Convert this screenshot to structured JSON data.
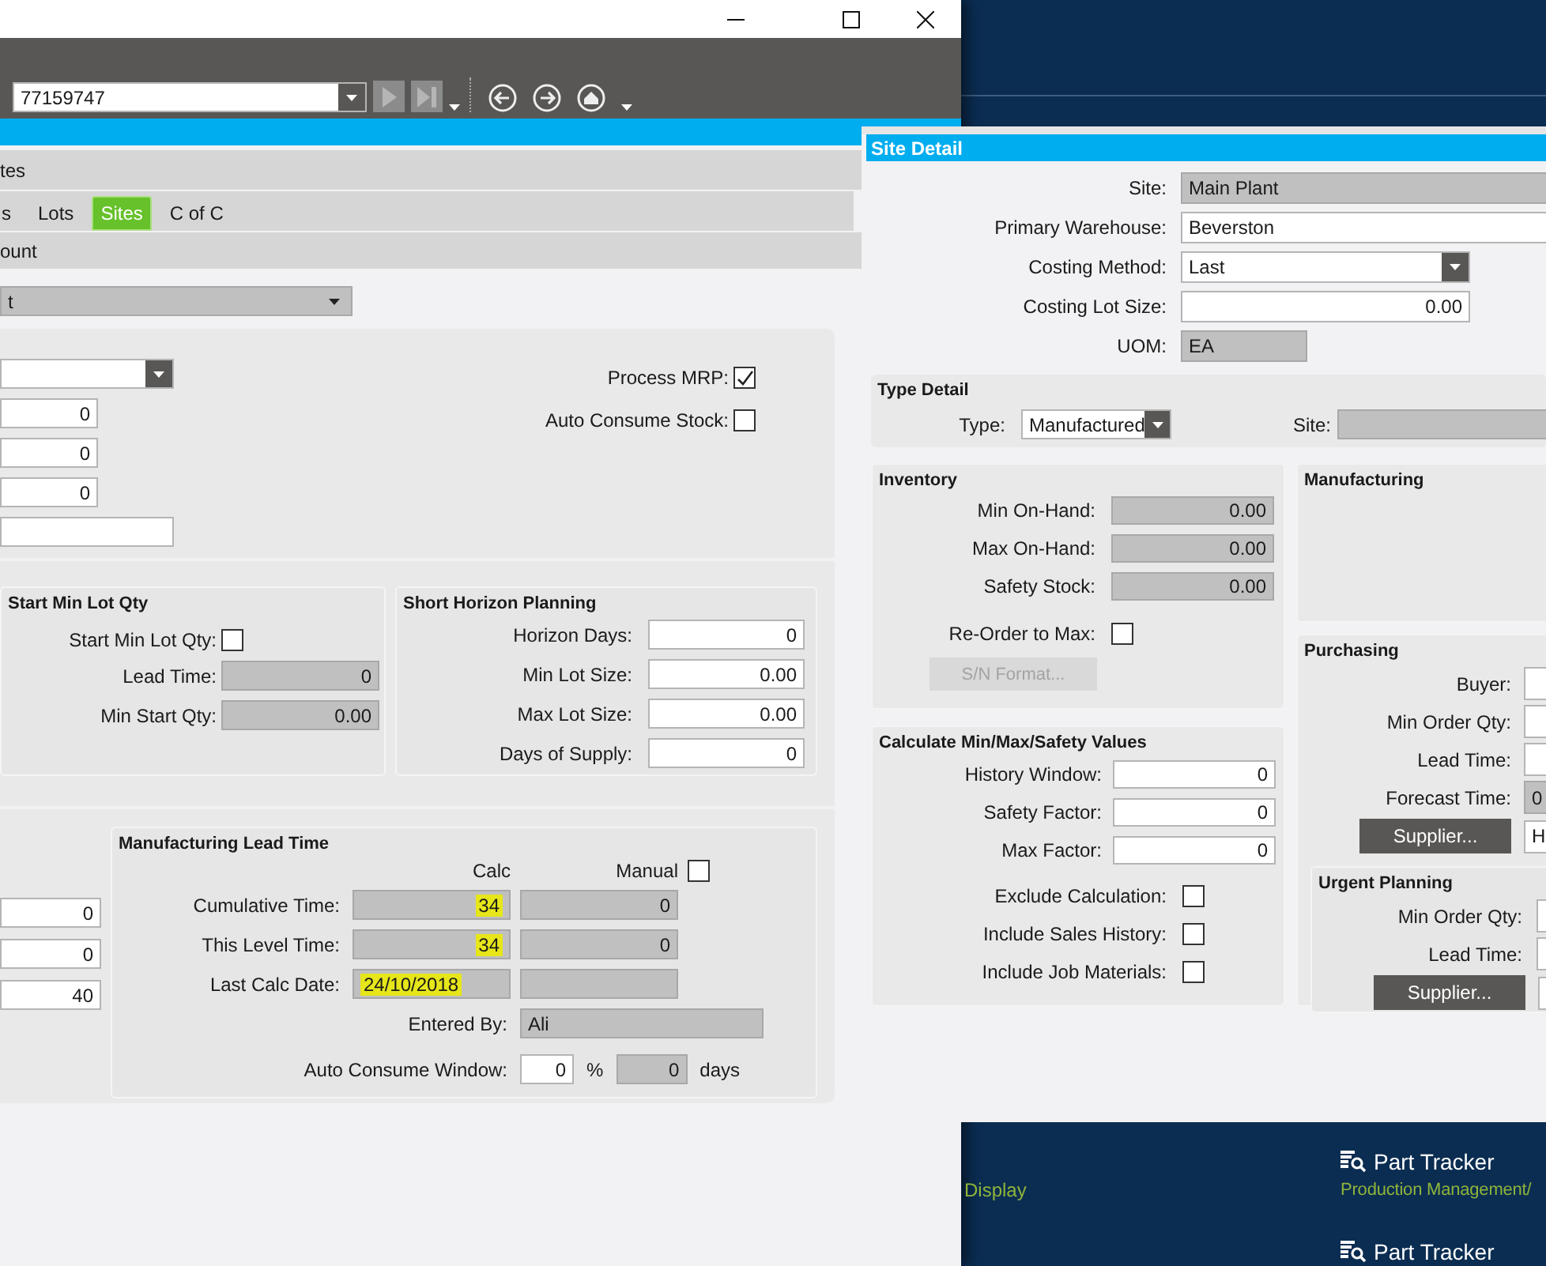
{
  "main_window": {
    "toolbar": {
      "record_field": {
        "kind": "dropdown",
        "value": "77159747"
      }
    },
    "top_bar": {
      "label": "tes"
    },
    "tabs": [
      {
        "label": "s",
        "selected": false
      },
      {
        "label": "Lots",
        "selected": false
      },
      {
        "label": "Sites",
        "selected": true
      },
      {
        "label": "C of C",
        "selected": false
      }
    ],
    "sub_bar": {
      "label": "ount"
    },
    "site_dropdown": {
      "kind": "dropdown",
      "value": "t",
      "read_only": true
    },
    "general_fields": [
      {
        "kind": "dropdown"
      },
      {
        "value": "0"
      },
      {
        "value": "0"
      },
      {
        "value": "0"
      },
      {
        "kind": "text"
      }
    ],
    "checks": [
      {
        "label": "Process MRP:",
        "checked": true
      },
      {
        "label": "Auto Consume Stock:",
        "checked": false
      }
    ],
    "start_min_lot_qty": {
      "title": "Start Min Lot Qty",
      "checkbox": {
        "label": "Start Min Lot Qty:",
        "checked": false
      },
      "fields": [
        {
          "label": "Lead Time:",
          "value": "0",
          "read_only": true
        },
        {
          "label": "Min Start Qty:",
          "value": "0.00",
          "read_only": true
        }
      ]
    },
    "short_horizon_planning": {
      "title": "Short Horizon Planning",
      "fields": [
        {
          "label": "Horizon Days:",
          "value": "0"
        },
        {
          "label": "Min Lot Size:",
          "value": "0.00"
        },
        {
          "label": "Max Lot Size:",
          "value": "0.00"
        },
        {
          "label": "Days of Supply:",
          "value": "0"
        }
      ]
    },
    "lead_fields": [
      {
        "value": "0"
      },
      {
        "value": "0"
      },
      {
        "value": "40"
      }
    ],
    "manufacturing_lead_time": {
      "title": "Manufacturing Lead Time",
      "calc_header": "Calc",
      "manual_header": "Manual",
      "manual_override": {
        "checked": false
      },
      "rows": [
        {
          "label": "Cumulative Time:",
          "calc": {
            "value": "34",
            "read_only": true,
            "highlighted": true
          },
          "manual": {
            "value": "0",
            "read_only": true
          }
        },
        {
          "label": "This Level Time:",
          "calc": {
            "value": "34",
            "read_only": true,
            "highlighted": true
          },
          "manual": {
            "value": "0",
            "read_only": true
          }
        },
        {
          "label": "Last Calc Date:",
          "calc": {
            "kind": "text",
            "value": "24/10/2018",
            "read_only": true,
            "highlighted": true
          },
          "manual": {
            "read_only": true
          }
        }
      ],
      "entered_by": {
        "label": "Entered By:",
        "field": {
          "kind": "text",
          "value": "Ali",
          "read_only": true
        }
      },
      "auto_consume_window": {
        "label": "Auto Consume Window:",
        "percent": {
          "value": "0"
        },
        "percent_sign": "%",
        "days": {
          "value": "0",
          "read_only": true
        },
        "unit": "days"
      }
    }
  },
  "site_detail": {
    "title": "Site Detail",
    "fields": [
      {
        "label": "Site:",
        "kind": "text",
        "value": "Main Plant",
        "read_only": true
      },
      {
        "label": "Primary Warehouse:",
        "kind": "text",
        "value": "Beverston"
      },
      {
        "label": "Costing Method:",
        "kind": "dropdown",
        "value": "Last"
      },
      {
        "label": "Costing Lot Size:",
        "value": "0.00"
      },
      {
        "label": "UOM:",
        "kind": "text",
        "value": "EA",
        "read_only": true
      }
    ],
    "type_detail": {
      "title": "Type Detail",
      "type": {
        "label": "Type:",
        "kind": "dropdown",
        "value": "Manufactured"
      },
      "site": {
        "label": "Site:",
        "read_only": true
      }
    },
    "inventory": {
      "title": "Inventory",
      "fields": [
        {
          "label": "Min On-Hand:",
          "value": "0.00",
          "read_only": true
        },
        {
          "label": "Max On-Hand:",
          "value": "0.00",
          "read_only": true
        },
        {
          "label": "Safety Stock:",
          "value": "0.00",
          "read_only": true
        }
      ],
      "reorder": {
        "label": "Re-Order to Max:",
        "checked": false
      },
      "sn_button": {
        "label": "S/N Format...",
        "disabled": true
      }
    },
    "calculate": {
      "title": "Calculate Min/Max/Safety Values",
      "fields": [
        {
          "label": "History Window:",
          "value": "0"
        },
        {
          "label": "Safety Factor:",
          "value": "0"
        },
        {
          "label": "Max Factor:",
          "value": "0"
        }
      ],
      "checks": [
        {
          "label": "Exclude Calculation:",
          "checked": false
        },
        {
          "label": "Include Sales History:",
          "checked": false
        },
        {
          "label": "Include Job Materials:",
          "checked": false
        }
      ]
    },
    "manufacturing": {
      "title": "Manufacturing"
    },
    "purchasing": {
      "title": "Purchasing",
      "fields": [
        {
          "label": "Buyer:"
        },
        {
          "label": "Min Order Qty:"
        },
        {
          "label": "Lead Time:"
        },
        {
          "label": "Forecast Time:",
          "kind": "text",
          "value": "0",
          "read_only": true
        }
      ],
      "supplier_button": {
        "label": "Supplier..."
      },
      "supplier_field": {
        "kind": "text",
        "value": "H"
      }
    },
    "urgent_planning": {
      "title": "Urgent Planning",
      "fields": [
        {
          "label": "Min Order Qty:"
        },
        {
          "label": "Lead Time:"
        }
      ],
      "supplier_button": {
        "label": "Supplier..."
      },
      "supplier_field": {
        "read_only": false
      }
    }
  },
  "desktop": {
    "display_label": "Display",
    "shortcuts": [
      {
        "title": "Part Tracker",
        "subtitle": "Production Management/"
      },
      {
        "title": "Part Tracker"
      }
    ]
  }
}
